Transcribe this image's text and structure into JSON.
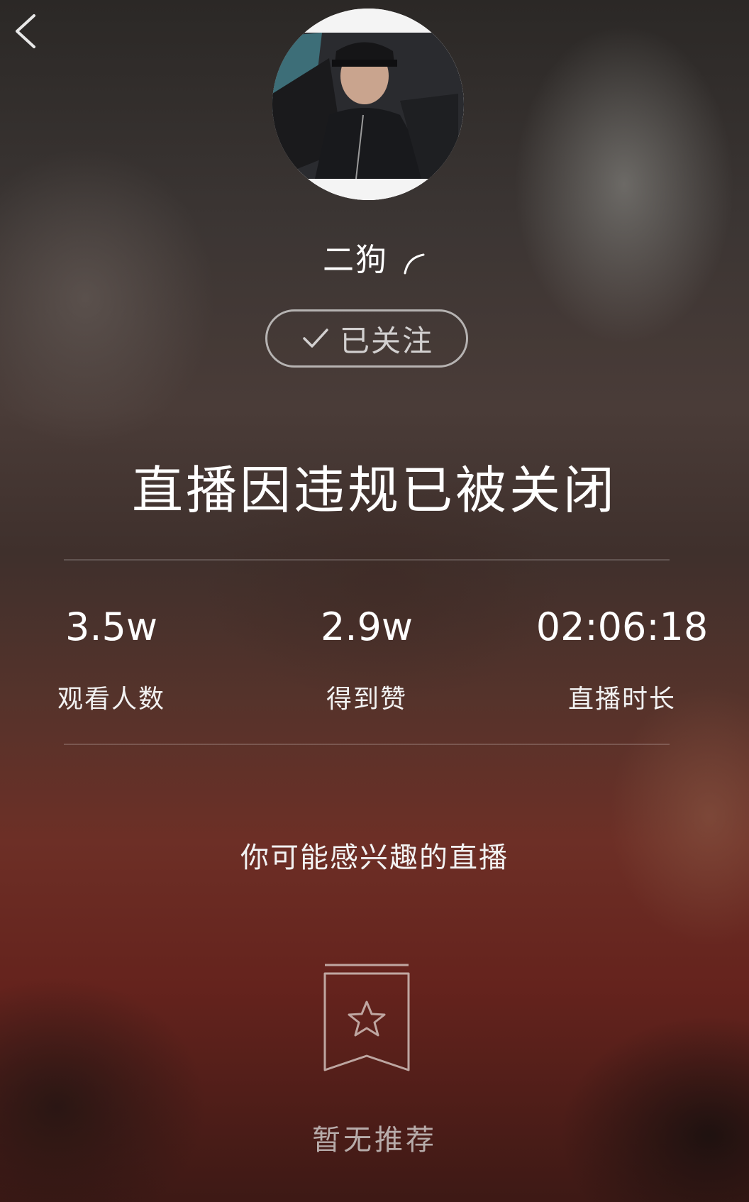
{
  "profile": {
    "name": "二狗",
    "follow_label": "已关注"
  },
  "status": {
    "title": "直播因违规已被关闭"
  },
  "stats": [
    {
      "value": "3.5w",
      "label": "观看人数"
    },
    {
      "value": "2.9w",
      "label": "得到赞"
    },
    {
      "value": "02:06:18",
      "label": "直播时长"
    }
  ],
  "recommendations": {
    "title": "你可能感兴趣的直播",
    "empty_text": "暂无推荐"
  },
  "icons": {
    "back": "chevron-left-icon",
    "gender": "gender-icon",
    "check": "check-icon",
    "empty": "bookmark-star-icon"
  }
}
